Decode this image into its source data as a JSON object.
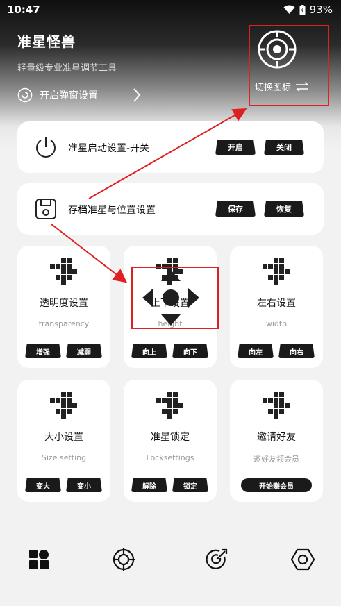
{
  "status": {
    "time": "10:47",
    "battery": "93%"
  },
  "header": {
    "title": "准星怪兽",
    "subtitle": "轻量级专业准星调节工具",
    "popup_label": "开启弹窗设置",
    "switch_label": "切换图标"
  },
  "power_card": {
    "label": "准星启动设置-开关",
    "on": "开启",
    "off": "关闭"
  },
  "save_card": {
    "label": "存档准星与位置设置",
    "save": "保存",
    "restore": "恢复"
  },
  "grid": [
    {
      "title": "透明度设置",
      "sub": "transparency",
      "btn1": "增强",
      "btn2": "减弱"
    },
    {
      "title": "上下设置",
      "sub": "height",
      "btn1": "向上",
      "btn2": "向下"
    },
    {
      "title": "左右设置",
      "sub": "width",
      "btn1": "向左",
      "btn2": "向右"
    },
    {
      "title": "大小设置",
      "sub": "Size setting",
      "btn1": "变大",
      "btn2": "变小"
    },
    {
      "title": "准星锁定",
      "sub": "Locksettings",
      "btn1": "解除",
      "btn2": "锁定"
    },
    {
      "title": "邀请好友",
      "sub": "邀好友领会员",
      "btn1": "开始赚会员"
    }
  ],
  "colors": {
    "accent_red": "#e02020",
    "dark": "#1a1a1a"
  }
}
